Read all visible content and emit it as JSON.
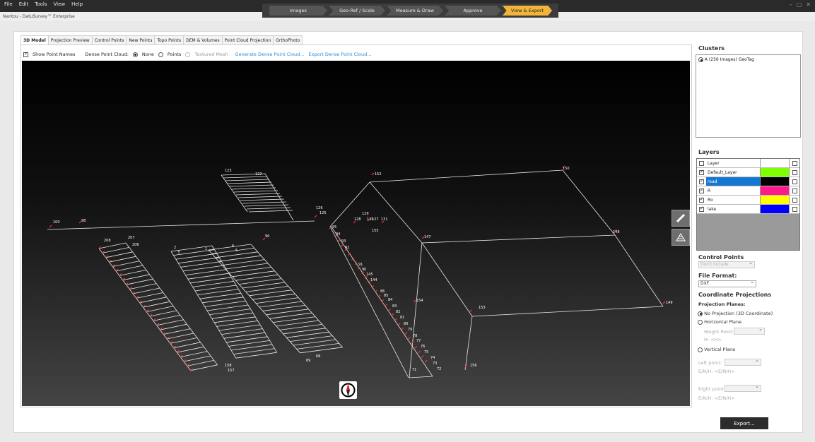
{
  "menu": [
    "File",
    "Edit",
    "Tools",
    "View",
    "Help"
  ],
  "window_controls": [
    "–",
    "▢",
    "✕"
  ],
  "app_title": "Nantou - DatuSurvey™ Enterprise",
  "workflow": [
    "Images",
    "Geo-Ref / Scale",
    "Measure & Draw",
    "Approve",
    "View & Export"
  ],
  "workflow_active": "View & Export",
  "tabs": [
    "3D Model",
    "Projection Preview",
    "Control Points",
    "New Points",
    "Topo Points",
    "DEM & Volumes",
    "Point Cloud Projection",
    "OrthoPhoto"
  ],
  "active_tab": "3D Model",
  "options": {
    "show_point_names": "Show Point Names",
    "dense_label": "Dense Point Cloud:",
    "none": "None",
    "points": "Points",
    "textured": "Textured Mesh",
    "generate": "Generate Dense Point Cloud...",
    "export_dense": "Export Dense Point Cloud..."
  },
  "clusters": {
    "title": "Clusters",
    "item": "A (256 Images) GeoTag"
  },
  "layers": {
    "title": "Layers",
    "header": "Layer",
    "rows": [
      {
        "name": "Default_Layer",
        "color": "#7fff00",
        "selected": false
      },
      {
        "name": "road",
        "color": "#000000",
        "selected": true
      },
      {
        "name": "R",
        "color": "#ff1a8c",
        "selected": false
      },
      {
        "name": "Ro",
        "color": "#ffff00",
        "selected": false
      },
      {
        "name": "lake",
        "color": "#0000ff",
        "selected": false
      }
    ]
  },
  "control_points": {
    "title": "Control Points",
    "value": "Don't include"
  },
  "file_format": {
    "title": "File Format:",
    "value": "DXF"
  },
  "coord": {
    "title": "Coordinate Projections",
    "planes": "Projection Planes:",
    "no_proj": "No Projection (3D Coordinate)",
    "horizontal": "Horizontal Plane",
    "height_point": "Height Point:",
    "h_line": "H:  <H>",
    "vertical": "Vertical Plane",
    "left_point": "Left point:",
    "left_enh": "E/N/H:   <E/N/H>",
    "right_point": "Right point:",
    "right_enh": "E/N/H:   <E/N/H>"
  },
  "export_button": "Export...",
  "scene": {
    "box_labels": [
      "150",
      "152",
      "147",
      "148",
      "149",
      "153",
      "154",
      "156"
    ],
    "misc_labels": [
      "100",
      "98",
      "96",
      "95",
      "94",
      "93",
      "92",
      "91",
      "90",
      "123",
      "122",
      "126",
      "125",
      "129",
      "130",
      "131",
      "155",
      "127",
      "128",
      "2",
      "3",
      "1",
      "6",
      "5",
      "206",
      "207",
      "208",
      "157",
      "158",
      "68",
      "69",
      "71",
      "72",
      "73",
      "74",
      "75",
      "76",
      "77",
      "78",
      "79",
      "80",
      "81",
      "82",
      "83",
      "84",
      "85",
      "86",
      "145",
      "144"
    ]
  }
}
